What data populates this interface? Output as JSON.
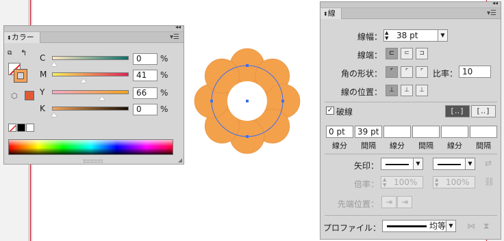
{
  "color_panel": {
    "tab_label": "カラー",
    "collapse_icon": "double-chevron",
    "menu_icon": "panel-menu",
    "channels": [
      {
        "label": "C",
        "value": "0",
        "unit": "%",
        "level": 0.0,
        "gradient": [
          "#ffe8c2",
          "#0f6f6a"
        ]
      },
      {
        "label": "M",
        "value": "41",
        "unit": "%",
        "level": 0.41,
        "gradient": [
          "#f6ef5a",
          "#e0245a"
        ]
      },
      {
        "label": "Y",
        "value": "66",
        "unit": "%",
        "level": 0.66,
        "gradient": [
          "#f2a8c8",
          "#f2a31f"
        ]
      },
      {
        "label": "K",
        "value": "0",
        "unit": "%",
        "level": 0.0,
        "gradient": [
          "#f5a65a",
          "#1a1008"
        ]
      }
    ],
    "stroke_color": "#f4a15a",
    "current_fill": "#e05a36"
  },
  "canvas": {
    "object_color": "#f4a14c",
    "selection_color": "#3b6ff0"
  },
  "stroke_panel": {
    "tab_label": "線",
    "weight_label": "線幅：",
    "weight_value": "38 pt",
    "cap_label": "線端：",
    "join_label": "角の形状：",
    "limit_label": "比率：",
    "limit_value": "10",
    "align_label": "線の位置：",
    "dashed_label": "破線",
    "dashed_checked": true,
    "dash_values": [
      "0 pt",
      "39 pt",
      "",
      "",
      "",
      ""
    ],
    "dash_labels": [
      "線分",
      "間隔",
      "線分",
      "間隔",
      "線分",
      "間隔"
    ],
    "arrow_label": "矢印：",
    "scale_label": "倍率：",
    "scale_values": [
      "100%",
      "100%"
    ],
    "position_label": "先端位置：",
    "profile_label": "プロファイル：",
    "profile_value": "均等"
  }
}
